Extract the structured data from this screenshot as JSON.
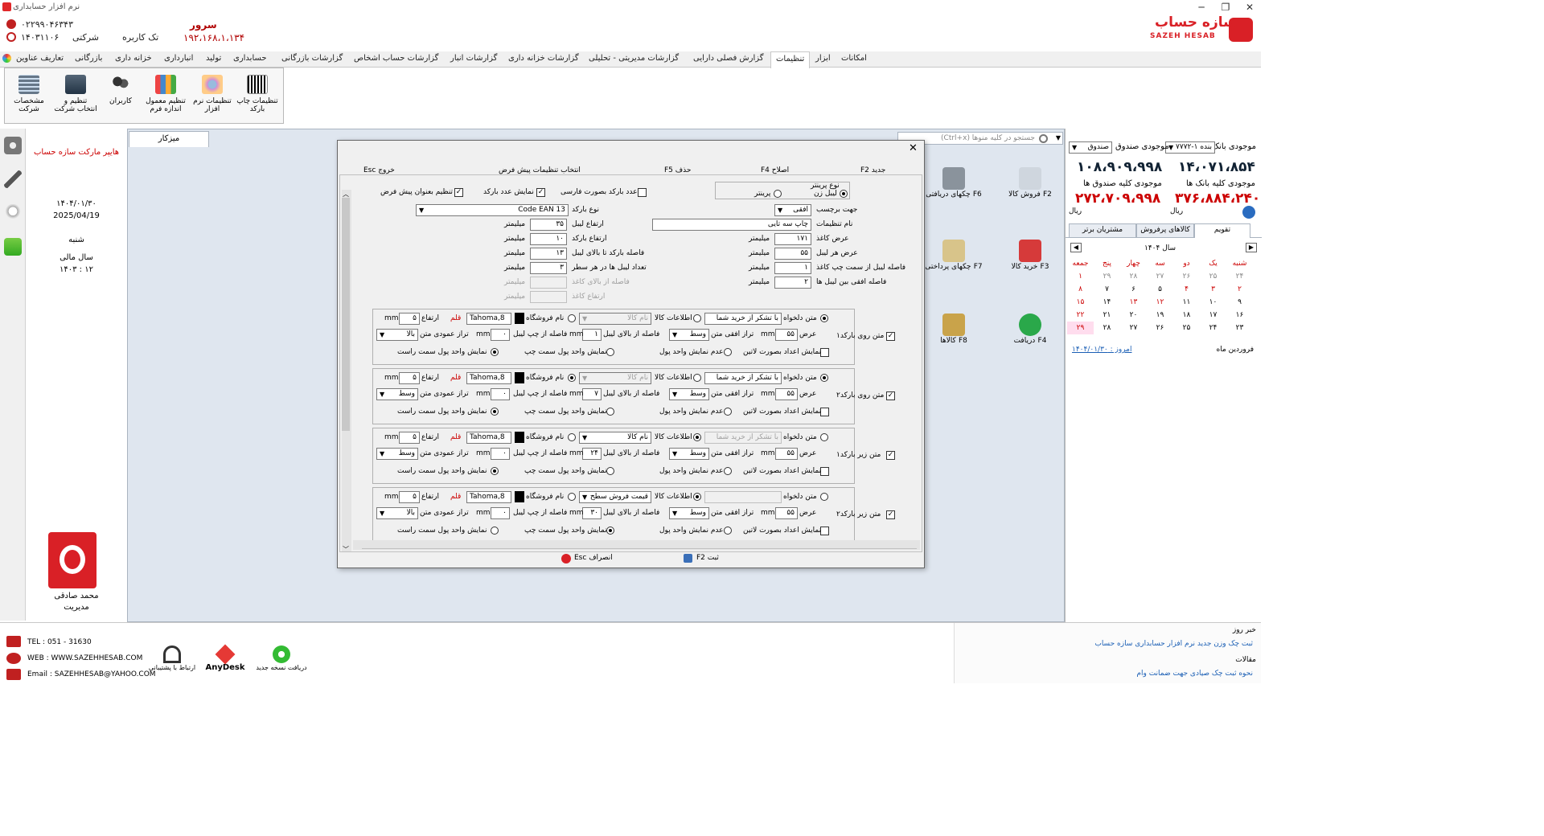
{
  "app": {
    "title": "نرم افزار حسابداری",
    "brand": "سازه حساب",
    "brand_en": "SAZEH HESAB"
  },
  "header": {
    "phone": "۰۲۲۹۹۰۴۶۳۴۳",
    "date": "۱۴۰۳۱۱۰۶",
    "company_label": "شرکتی",
    "user_mode": "تک کاربره",
    "server_label": "سرور",
    "server_ip": "۱۹۲،۱۶۸،۱،۱۳۴"
  },
  "menu": [
    "امکانات",
    "ابزار",
    "تنظیمات",
    "گزارش فصلی دارایی",
    "گزارشات مدیریتی - تحلیلی",
    "گزارشات خزانه داری",
    "گزارشات انبار",
    "گزارشات حساب اشخاص",
    "گزارشات بازرگانی",
    "حسابداری",
    "تولید",
    "انبارداری",
    "خزانه داری",
    "بازرگانی",
    "تعاریف عناوین"
  ],
  "ribbon": [
    {
      "label": "تنظیمات چاپ بارکد"
    },
    {
      "label": "تنظیمات نرم افزار"
    },
    {
      "label": "تنظیم معمول اندازه فرم"
    },
    {
      "label": "کاربران"
    },
    {
      "label": "تنظیم و انتخاب شرکت"
    },
    {
      "label": "مشخصات شرکت"
    }
  ],
  "left": {
    "store": "هایپر مارکت سازه حساب",
    "date_fa": "۱۴۰۴/۰۱/۳۰",
    "date_en": "2025/04/19",
    "weekday": "شنبه",
    "fiscal_label": "سال مالی",
    "fiscal": "۱۴۰۳ : ۱۲",
    "user": "محمد صادقی",
    "role": "مدیریت"
  },
  "tab": {
    "label": "میزکار"
  },
  "search": {
    "placeholder": "جستجو در کلیه منوها (Ctrl+x)"
  },
  "desk": [
    {
      "label": "فروش کالا",
      "key": "F2"
    },
    {
      "label": "چکهای دریافتی",
      "key": "F6"
    },
    {
      "label": "خرید کالا",
      "key": "F3"
    },
    {
      "label": "چکهای پرداختی",
      "key": "F7"
    },
    {
      "label": "دریافت",
      "key": "F4"
    },
    {
      "label": "کالاها",
      "key": "F8"
    }
  ],
  "right": {
    "bank_label": "موجودی بانک",
    "bank_sel": "بنده ۱-۷۷۷۲",
    "cash_label": "موجودی صندوق",
    "cash_sel": "صندوق",
    "bank_val": "۱۴،۰۷۱،۸۵۴",
    "cash_val": "۱۰۸،۹۰۹،۹۹۸",
    "all_bank_label": "موجودی کلیه بانک ها",
    "all_cash_label": "موجودی کلیه صندوق ها",
    "all_bank_val": "۳۷۶،۸۸۴،۲۴۰",
    "all_cash_val": "۲۷۲،۷۰۹،۹۹۸",
    "rial": "ریال",
    "tabs": [
      "تقویم",
      "کالاهای پرفروش",
      "مشتریان برتر"
    ],
    "month": "فروردین ماه",
    "year": "سال ۱۴۰۴",
    "today": "امروز : ۱۴۰۴/۰۱/۳۰",
    "weekdays": [
      "شنبه",
      "یک",
      "دو",
      "سه",
      "چهار",
      "پنج",
      "جمعه"
    ],
    "weeks": [
      [
        "۲۴",
        "۲۵",
        "۲۶",
        "۲۷",
        "۲۸",
        "۲۹",
        "۱"
      ],
      [
        "۲",
        "۳",
        "۴",
        "۵",
        "۶",
        "۷",
        "۸"
      ],
      [
        "۹",
        "۱۰",
        "۱۱",
        "۱۲",
        "۱۳",
        "۱۴",
        "۱۵"
      ],
      [
        "۱۶",
        "۱۷",
        "۱۸",
        "۱۹",
        "۲۰",
        "۲۱",
        "۲۲"
      ],
      [
        "۲۳",
        "۲۴",
        "۲۵",
        "۲۶",
        "۲۷",
        "۲۸",
        "۲۹"
      ]
    ]
  },
  "news": {
    "title": "خبر روز",
    "item": "ثبت چک وزن جدید نرم افزار حسابداری سازه حساب",
    "articles": "مقالات",
    "article": "نحوه ثبت چک صیادی جهت ضمانت وام"
  },
  "bottom": {
    "tel": "TEL : 051 - 31630",
    "web": "WEB : WWW.SAZEHHESAB.COM",
    "email": "Email : SAZEHHESAB@YAHOO.COM",
    "support": "ارتباط با پشتیبانی",
    "anydesk": "AnyDesk",
    "update": "دریافت نسخه جدید"
  },
  "dialog": {
    "toolbar": [
      "جدید F2",
      "اصلاح F4",
      "حذف F5",
      "انتخاب تنظیمات پیش فرض",
      "خروج Esc"
    ],
    "printer_type": "نوع پرینتر",
    "label_printer": "لیبل زن",
    "printer": "پرینتر",
    "chk_persian": "عدد بارکد بصورت فارسی",
    "chk_show": "نمایش عدد بارکد",
    "chk_default": "تنظیم بعنوان پیش فرض",
    "direction_label": "جهت برچسب",
    "direction": "افقی",
    "barcode_type_label": "نوع بارکد",
    "barcode_type": "Code EAN 13",
    "name_label": "نام تنظیمات",
    "name": "چاپ سه تایی",
    "mm": "میلیمتر",
    "left_fields": [
      {
        "label": "ارتفاع لیبل",
        "value": "۳۵"
      },
      {
        "label": "ارتفاع بارکد",
        "value": "۱۰"
      },
      {
        "label": "فاصله بارکد تا بالای لیبل",
        "value": "۱۳"
      },
      {
        "label": "تعداد لیبل ها در هر سطر",
        "value": "۳"
      },
      {
        "label": "فاصله از بالای کاغذ",
        "value": ""
      },
      {
        "label": "ارتفاع کاغذ",
        "value": ""
      }
    ],
    "right_fields": [
      {
        "label": "عرض کاغذ",
        "value": "۱۷۱"
      },
      {
        "label": "عرض هر لیبل",
        "value": "۵۵"
      },
      {
        "label": "فاصله لیبل از سمت چپ کاغذ",
        "value": "۱"
      },
      {
        "label": "فاصله افقی بین لیبل ها",
        "value": "۲"
      }
    ],
    "group_labels": {
      "custom": "متن دلخواه",
      "goods": "اطلاعات کالا",
      "store": "نام فروشگاه",
      "font": "قلم",
      "height": "ارتفاع",
      "width": "عرض",
      "halign": "تراز افقی متن",
      "top_dist": "فاصله از بالای لیبل",
      "left_dist": "فاصله از چپ لیبل",
      "valign": "تراز عمودی متن",
      "latin": "نمایش اعداد بصورت لاتین",
      "no_unit": "عدم نمایش واحد پول",
      "unit_left": "نمایش واحد پول سمت چپ",
      "unit_right": "نمایش واحد پول سمت راست",
      "mm": "mm"
    },
    "groups": [
      {
        "title": "متن روی بارکد۱",
        "custom": "با تشکر از خرید شما",
        "goods": "نام کالا",
        "font": "Tahoma,8",
        "height": "۵",
        "width": "۵۵",
        "halign": "وسط",
        "top": "۱",
        "left": "۰",
        "valign": "بالا"
      },
      {
        "title": "متن روی بارکد۲",
        "custom": "با تشکر از خرید شما",
        "goods": "نام کالا",
        "font": "Tahoma,8",
        "height": "۵",
        "width": "۵۵",
        "halign": "وسط",
        "top": "۷",
        "left": "۰",
        "valign": "وسط"
      },
      {
        "title": "متن زیر بارکد۱",
        "custom": "با تشکر از خرید شما",
        "goods": "نام کالا",
        "font": "Tahoma,8",
        "height": "۵",
        "width": "۵۵",
        "halign": "وسط",
        "top": "۲۴",
        "left": "۰",
        "valign": "وسط"
      },
      {
        "title": "متن زیر بارکد۲",
        "custom": "",
        "goods": "قیمت فروش سطح",
        "font": "Tahoma,8",
        "height": "۵",
        "width": "۵۵",
        "halign": "وسط",
        "top": "۳۰",
        "left": "۰",
        "valign": "بالا"
      }
    ],
    "save": "ثبت F2",
    "cancel": "انصراف Esc"
  }
}
